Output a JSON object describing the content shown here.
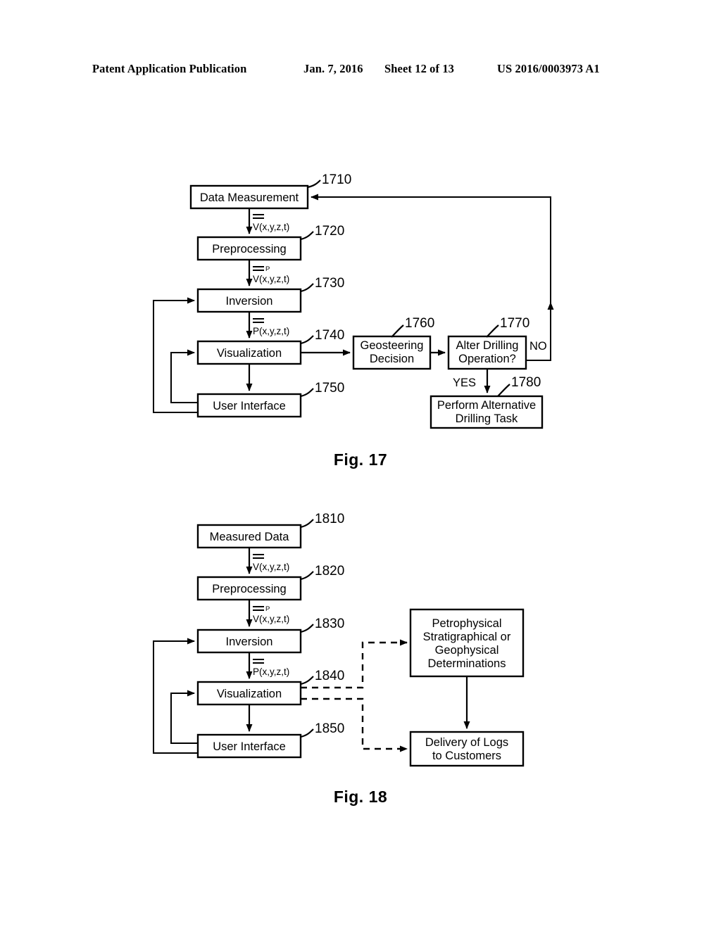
{
  "header": {
    "publication": "Patent Application Publication",
    "date": "Jan. 7, 2016",
    "sheet": "Sheet 12 of 13",
    "patent_number": "US 2016/0003973 A1"
  },
  "figures": [
    {
      "caption": "Fig. 17",
      "nodes": [
        {
          "id": "1710",
          "label": "Data Measurement",
          "ref": "1710"
        },
        {
          "id": "1720",
          "label": "Preprocessing",
          "ref": "1720"
        },
        {
          "id": "1730",
          "label": "Inversion",
          "ref": "1730"
        },
        {
          "id": "1740",
          "label": "Visualization",
          "ref": "1740"
        },
        {
          "id": "1750",
          "label": "User Interface",
          "ref": "1750"
        },
        {
          "id": "1760",
          "label_line1": "Geosteering",
          "label_line2": "Decision",
          "ref": "1760"
        },
        {
          "id": "1770",
          "label_line1": "Alter Drilling",
          "label_line2": "Operation?",
          "ref": "1770"
        },
        {
          "id": "1780",
          "label_line1": "Perform Alternative",
          "label_line2": "Drilling Task",
          "ref": "1780"
        }
      ],
      "edge_labels": [
        {
          "id": "e1",
          "bar": "=",
          "sup": "",
          "expr": "V(x,y,z,t)"
        },
        {
          "id": "e2",
          "bar": "=",
          "sup": "P",
          "expr": "V(x,y,z,t)"
        },
        {
          "id": "e3",
          "bar": "=",
          "sup": "",
          "expr": "P(x,y,z,t)"
        }
      ],
      "decision_labels": {
        "no": "NO",
        "yes": "YES"
      }
    },
    {
      "caption": "Fig. 18",
      "nodes": [
        {
          "id": "1810",
          "label": "Measured Data",
          "ref": "1810"
        },
        {
          "id": "1820",
          "label": "Preprocessing",
          "ref": "1820"
        },
        {
          "id": "1830",
          "label": "Inversion",
          "ref": "1830"
        },
        {
          "id": "1840",
          "label": "Visualization",
          "ref": "1840"
        },
        {
          "id": "1850",
          "label": "User Interface",
          "ref": "1850"
        },
        {
          "id": "petro",
          "label_line1": "Petrophysical",
          "label_line2": "Stratigraphical or",
          "label_line3": "Geophysical",
          "label_line4": "Determinations"
        },
        {
          "id": "delivery",
          "label_line1": "Delivery of Logs",
          "label_line2": "to Customers"
        }
      ],
      "edge_labels": [
        {
          "id": "f1",
          "bar": "=",
          "sup": "",
          "expr": "V(x,y,z,t)"
        },
        {
          "id": "f2",
          "bar": "=",
          "sup": "P",
          "expr": "V(x,y,z,t)"
        },
        {
          "id": "f3",
          "bar": "=",
          "sup": "",
          "expr": "P(x,y,z,t)"
        }
      ]
    }
  ],
  "colors": {
    "ink": "#000000",
    "paper": "#ffffff"
  }
}
